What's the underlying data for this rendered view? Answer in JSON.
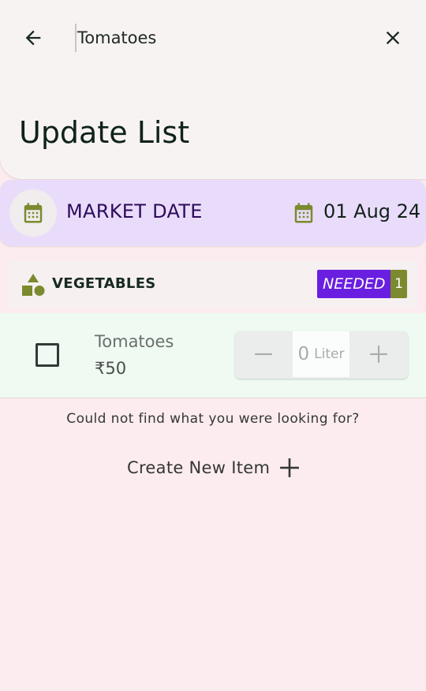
{
  "search": {
    "value": "Tomatoes"
  },
  "page_title": "Update List",
  "market": {
    "label": "MARKET DATE",
    "date": "01 Aug 24"
  },
  "category": {
    "icon": "shapes-icon",
    "name": "VEGETABLES",
    "badge": "NEEDED",
    "count": "1"
  },
  "item": {
    "name": "Tomatoes",
    "price": "₹50",
    "quantity": "0",
    "unit": "Liter",
    "checked": false
  },
  "footer": {
    "not_found": "Could not find what you were looking for?",
    "create_label": "Create New Item"
  },
  "colors": {
    "page_bg": "#fdecef",
    "topbar_bg": "#f8f3f3",
    "market_bg": "#e9dcfb",
    "accent_green": "#7b8a2e",
    "badge_purple": "#6a1fe0",
    "item_row_bg": "#eefaf2"
  }
}
